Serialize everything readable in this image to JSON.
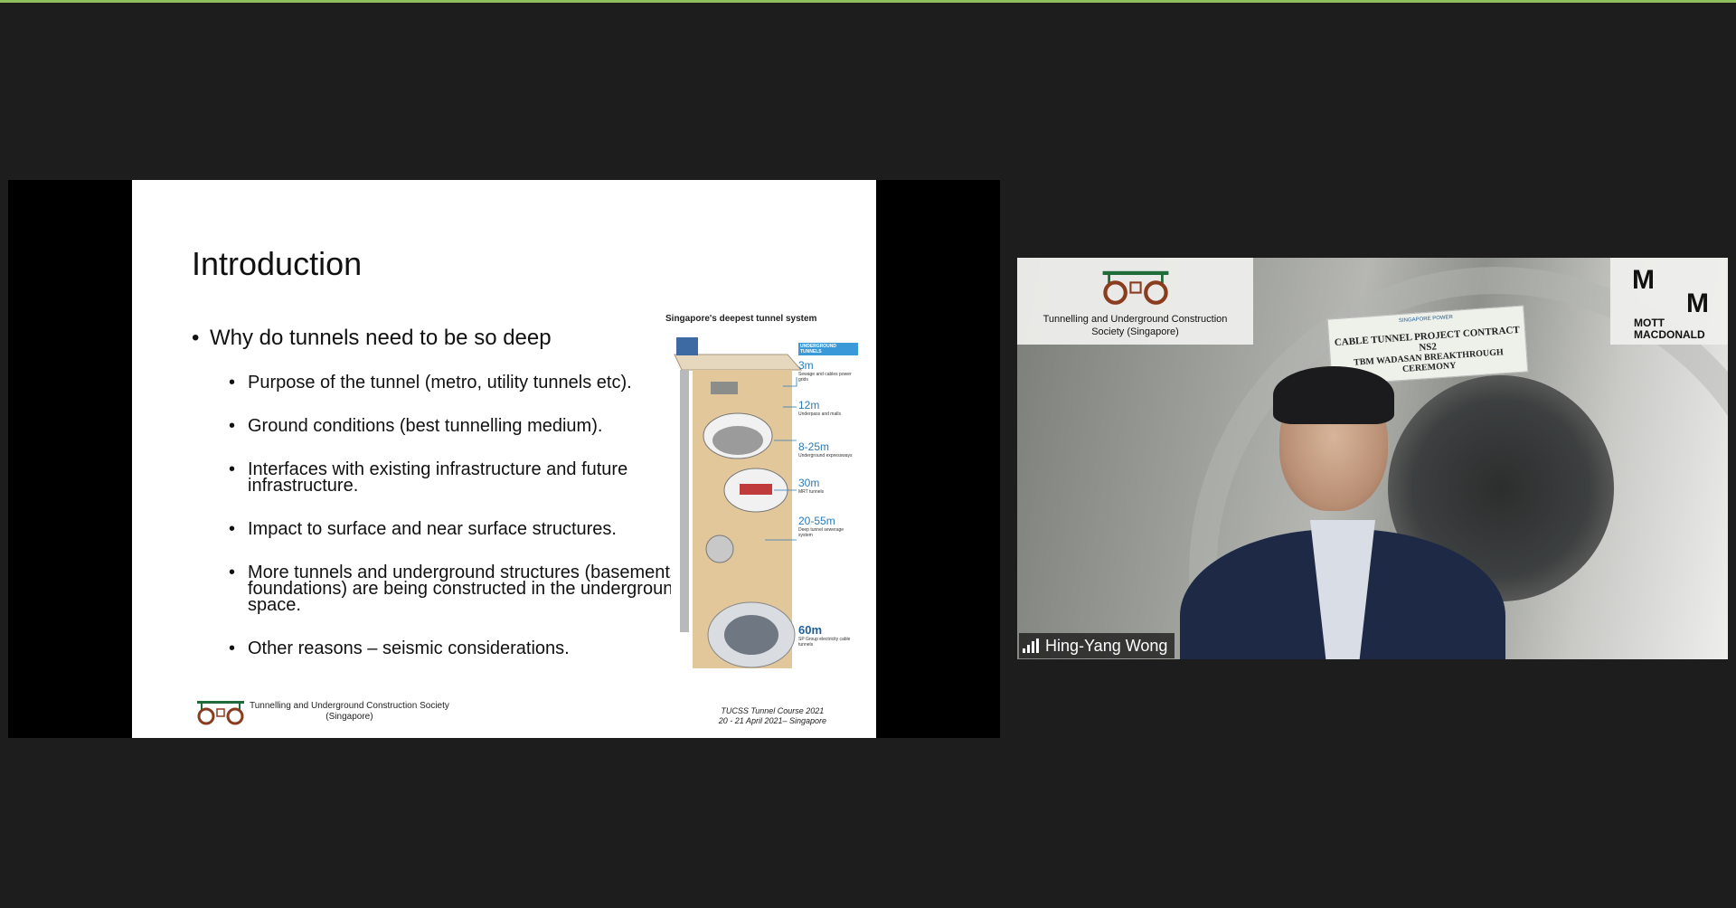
{
  "slide": {
    "title": "Introduction",
    "main_bullet": "Why do tunnels need to be so deep",
    "sub_bullets": [
      "Purpose of the tunnel (metro, utility tunnels etc).",
      "Ground conditions (best tunnelling medium).",
      "Interfaces with existing infrastructure and future infrastructure.",
      "Impact to surface and near surface structures.",
      "More tunnels and underground structures (basements, foundations) are being constructed in the underground space.",
      "Other reasons – seismic considerations."
    ],
    "figure": {
      "title": "Singapore's deepest tunnel system",
      "header_label": "UNDERGROUND TUNNELS",
      "depths": [
        {
          "value": "3m",
          "desc": "Sewage and cables power grids"
        },
        {
          "value": "12m",
          "desc": "Underpass and malls"
        },
        {
          "value": "8-25m",
          "desc": "Underground expressways"
        },
        {
          "value": "30m",
          "desc": "MRT tunnels"
        },
        {
          "value": "20-55m",
          "desc": "Deep tunnel sewerage system"
        },
        {
          "value": "60m",
          "desc": "SP Group electricity cable tunnels"
        }
      ]
    },
    "footer_org_line1": "Tunnelling and Underground Construction Society",
    "footer_org_line2": "(Singapore)",
    "footer_course_line1": "TUCSS Tunnel Course 2021",
    "footer_course_line2": "20 - 21 April 2021– Singapore"
  },
  "video": {
    "org_badge_line1": "Tunnelling and Underground Construction",
    "org_badge_line2": "Society (Singapore)",
    "mott_line1": "MOTT",
    "mott_line2": "MACDONALD",
    "mott_letter": "M",
    "banner_line0": "SINGAPORE POWER",
    "banner_line1": "CABLE TUNNEL PROJECT CONTRACT NS2",
    "banner_line2": "TBM WADASAN BREAKTHROUGH CEREMONY",
    "participant_name": "Hing-Yang Wong"
  },
  "colors": {
    "logo_green": "#1f6b3a",
    "logo_brown": "#8a3d1e",
    "depth_blue": "#2a7ab8",
    "background": "#1d1d1d"
  }
}
